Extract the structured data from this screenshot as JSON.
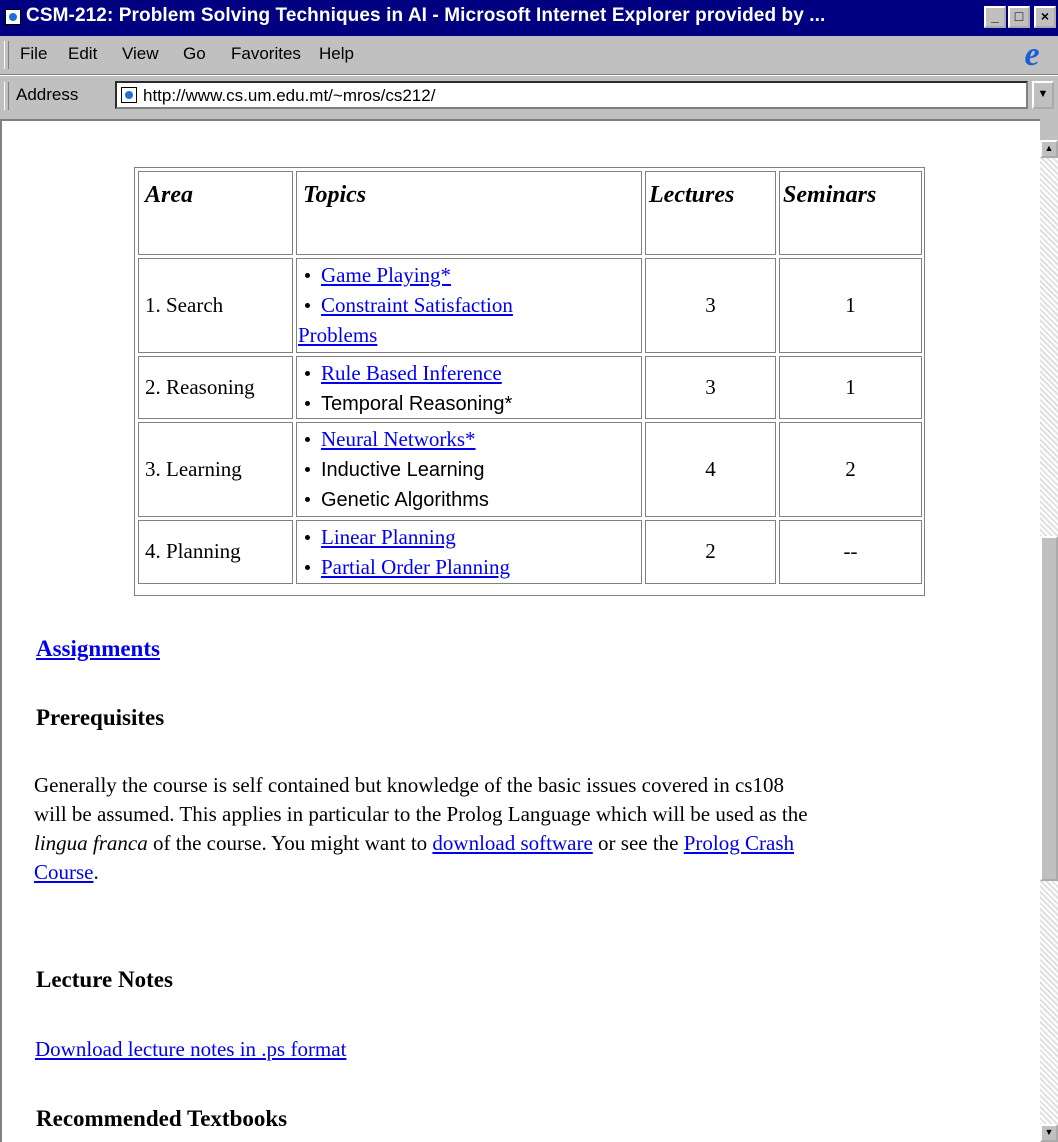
{
  "window": {
    "title": "CSM-212: Problem Solving Techniques in AI - Microsoft Internet Explorer provided by ...",
    "controls": {
      "minimize": "_",
      "maximize": "□",
      "close": "×"
    }
  },
  "menubar": {
    "items": [
      "File",
      "Edit",
      "View",
      "Go",
      "Favorites",
      "Help"
    ]
  },
  "address": {
    "label": "Address",
    "url": "http://www.cs.um.edu.mt/~mros/cs212/"
  },
  "table": {
    "headers": [
      "Area",
      "Topics",
      "Lectures",
      "Seminars"
    ],
    "rows": [
      {
        "area": "1. Search",
        "topics": [
          {
            "text": "Game Playing*",
            "link": true
          },
          {
            "text": "Constraint Satisfaction",
            "link": true
          },
          {
            "text": "Problems",
            "link": true
          }
        ],
        "lectures": "3",
        "seminars": "1"
      },
      {
        "area": "2. Reasoning",
        "topics": [
          {
            "text": "Rule Based Inference",
            "link": true
          },
          {
            "text": "Temporal Reasoning*",
            "link": false
          }
        ],
        "lectures": "3",
        "seminars": "1"
      },
      {
        "area": "3. Learning",
        "topics": [
          {
            "text": "Neural Networks*",
            "link": true
          },
          {
            "text": "Inductive Learning",
            "link": false
          },
          {
            "text": "Genetic Algorithms",
            "link": false
          }
        ],
        "lectures": "4",
        "seminars": "2"
      },
      {
        "area": "4. Planning",
        "topics": [
          {
            "text": "Linear Planning",
            "link": true
          },
          {
            "text": "Partial Order Planning",
            "link": true
          }
        ],
        "lectures": "2",
        "seminars": "--"
      }
    ]
  },
  "assignments_link": "Assignments",
  "prerequisites": {
    "heading": "Prerequisites",
    "line1": "Generally the course is self contained but knowledge of the basic issues covered in cs108",
    "line2": "will be assumed. This applies in particular to the Prolog Language which will be used as the",
    "line3_em": "lingua franca",
    "line3_a": " of the course. You might want to ",
    "link_download": "download software",
    "line3_b": " or see the ",
    "link_crash_1": "Prolog Crash",
    "link_crash_2": "Course",
    "line4_end": "."
  },
  "lecture_notes": {
    "heading": "Lecture Notes",
    "link": "Download lecture notes in .ps format"
  },
  "textbooks": {
    "heading": "Recommended Textbooks"
  }
}
